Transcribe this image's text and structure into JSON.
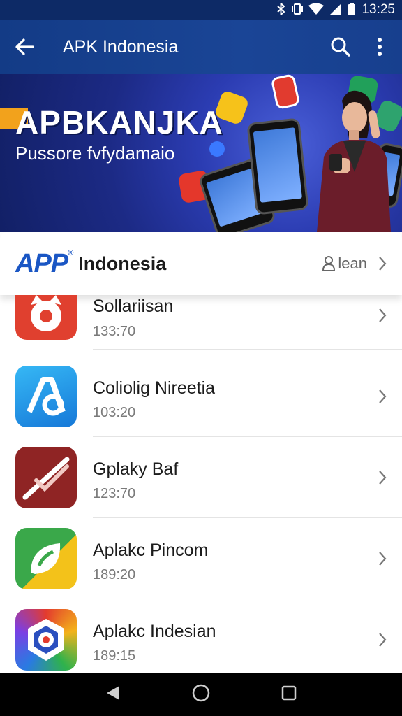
{
  "status_bar": {
    "time": "13:25"
  },
  "app_bar": {
    "title": "APK Indonesia"
  },
  "banner": {
    "headline": "APBKANJKA",
    "subline": "Pussore fvfydamaio"
  },
  "brand": {
    "logo": "APP",
    "name": "Indonesia",
    "login_label": "lean"
  },
  "apps": [
    {
      "name": "Sollariisan",
      "meta": "133:70"
    },
    {
      "name": "Coliolig Nireetia",
      "meta": "103:20"
    },
    {
      "name": "Gplaky Baf",
      "meta": "123:70"
    },
    {
      "name": "Aplakc Pincom",
      "meta": "189:20"
    },
    {
      "name": "Aplakc Indesian",
      "meta": "189:15"
    }
  ],
  "colors": {
    "app_bar": "#1a4596",
    "status_bar": "#0d2a66",
    "brand_blue": "#1a56c4"
  }
}
